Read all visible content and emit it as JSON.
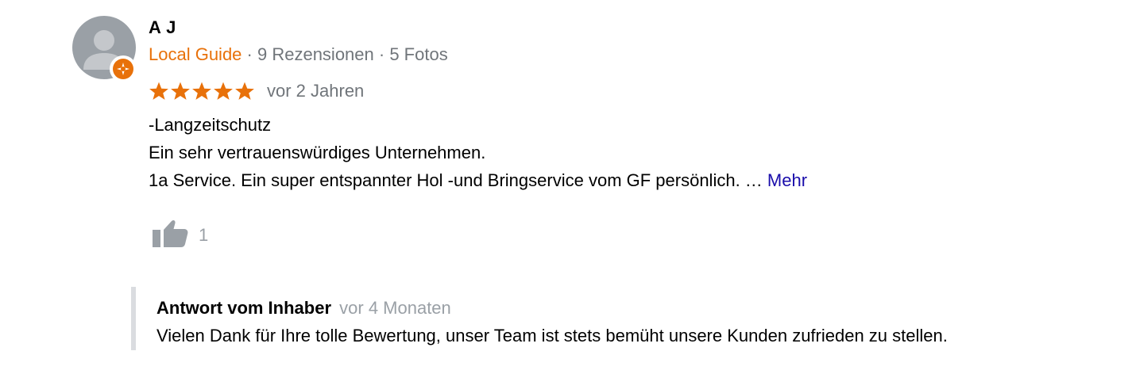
{
  "review": {
    "author": {
      "name": "A J",
      "guide_label": "Local Guide",
      "reviews": "9 Rezensionen",
      "photos": "5 Fotos",
      "separator": " · "
    },
    "rating": 5,
    "rating_max": 5,
    "star_color": "#e8710a",
    "time": "vor 2 Jahren",
    "text_lines": [
      "-Langzeitschutz",
      "Ein sehr vertrauenswürdiges Unternehmen.",
      "1a Service. Ein super entspannter Hol -und Bringservice vom GF persönlich. …"
    ],
    "more_label": "Mehr",
    "likes": "1",
    "icons": {
      "avatar": "default-avatar-icon",
      "badge": "local-guide-badge-icon",
      "star": "star-icon",
      "like": "thumbs-up-icon"
    }
  },
  "owner_response": {
    "label": "Antwort vom Inhaber",
    "time": "vor 4 Monaten",
    "text": "Vielen Dank für Ihre tolle Bewertung, unser Team ist stets bemüht unsere Kunden zufrieden zu stellen."
  }
}
